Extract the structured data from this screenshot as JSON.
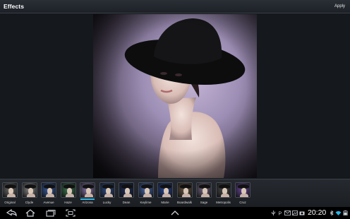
{
  "header": {
    "title": "Effects",
    "apply_label": "Apply"
  },
  "effects": [
    {
      "label": "Original",
      "tint": "#6e6e6e"
    },
    {
      "label": "Clyde",
      "tint": "#8a8a8a"
    },
    {
      "label": "Avenue",
      "tint": "#3a5fa8"
    },
    {
      "label": "Haze",
      "tint": "#3e7a52"
    },
    {
      "label": "Arizona",
      "tint": "#8c7ab0"
    },
    {
      "label": "Lucky",
      "tint": "#2f4f8c"
    },
    {
      "label": "Dean",
      "tint": "#1f2f5e"
    },
    {
      "label": "Keylime",
      "tint": "#4a6ab0"
    },
    {
      "label": "Marie",
      "tint": "#2a4a9e"
    },
    {
      "label": "Boardwalk",
      "tint": "#6b5a46"
    },
    {
      "label": "Sage",
      "tint": "#7a6a86"
    },
    {
      "label": "Metropolis",
      "tint": "#4a4a4a"
    },
    {
      "label": "Cruz",
      "tint": "#6a4aa0"
    }
  ],
  "selected_effect": "Arizona",
  "status": {
    "clock": "20:20"
  },
  "icons": {
    "back": "back-arrow-icon",
    "home": "home-icon",
    "recents": "recent-apps-icon",
    "screenshot": "screenshot-icon",
    "up": "chevron-up-icon"
  },
  "colors": {
    "accent": "#2bb4e6",
    "background": "#15181c"
  }
}
